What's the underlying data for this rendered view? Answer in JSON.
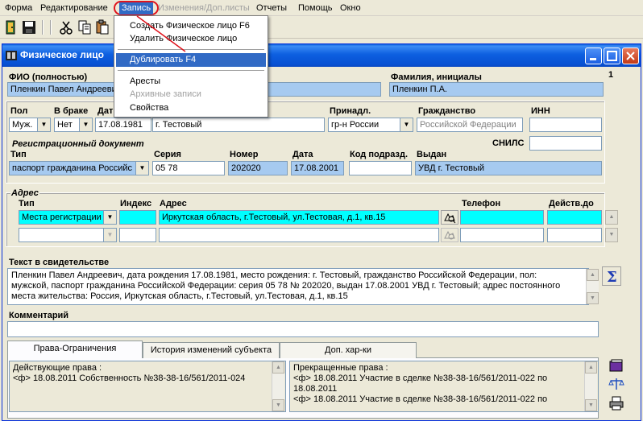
{
  "menubar": {
    "items": [
      "Форма",
      "Редактирование",
      "Запись",
      "Изменения/Доп.листы",
      "Отчеты",
      "Помощь",
      "Окно"
    ]
  },
  "dropdown": {
    "items": [
      {
        "label": "Создать Физическое лицо F6",
        "state": "normal"
      },
      {
        "label": "Удалить Физическое лицо",
        "state": "normal"
      },
      {
        "label": "Дублировать F4",
        "state": "highlighted"
      },
      {
        "label": "Аресты",
        "state": "normal"
      },
      {
        "label": "Архивные записи",
        "state": "disabled"
      },
      {
        "label": "Свойства",
        "state": "normal"
      }
    ]
  },
  "window": {
    "title": "Физическое лицо",
    "page_number": "1"
  },
  "form": {
    "fio_label": "ФИО (полностью)",
    "fio_value": "Пленкин Павел Андреевич",
    "surname_label": "Фамилия, инициалы",
    "surname_value": "Пленкин П.А.",
    "sex_label": "Пол",
    "sex_value": "Муж.",
    "married_label": "В браке",
    "married_value": "Нет",
    "birth_label": "Дат",
    "birth_value": "17.08.1981",
    "birthplace_value": "г. Тестовый",
    "affil_label": "Принадл.",
    "affil_value": "гр-н России",
    "citizen_label": "Гражданство",
    "citizen_value": "Российской Федерации",
    "inn_label": "ИНН",
    "inn_value": "",
    "snils_label": "СНИЛС",
    "snils_value": "",
    "regdoc_label": "Регистрационный документ",
    "doc_type_label": "Тип",
    "doc_type_value": "паспорт гражданина Российс",
    "series_label": "Серия",
    "series_value": "05 78",
    "number_label": "Номер",
    "number_value": "202020",
    "date_label": "Дата",
    "date_value": "17.08.2001",
    "subdiv_label": "Код подразд.",
    "subdiv_value": "",
    "issued_label": "Выдан",
    "issued_value": "УВД г. Тестовый",
    "address_group_label": "Адрес",
    "addr_type_label": "Тип",
    "addr_index_label": "Индекс",
    "addr_label": "Адрес",
    "phone_label": "Телефон",
    "valid_label": "Действ.до",
    "addr_rows": [
      {
        "type": "Места регистрации",
        "index": "",
        "address": "Иркутская область, г.Тестовый, ул.Тестовая, д.1, кв.15",
        "phone": "",
        "valid": ""
      },
      {
        "type": "",
        "index": "",
        "address": "",
        "phone": "",
        "valid": ""
      }
    ],
    "cert_label": "Текст в свидетельстве",
    "cert_text": "Пленкин Павел Андреевич, дата рождения 17.08.1981, место рождения: г. Тестовый, гражданство Российской Федерации, пол: мужской, паспорт гражданина Российской Федерации: серия 05 78 № 202020, выдан 17.08.2001 УВД г. Тестовый; адрес постоянного места жительства: Россия, Иркутская область, г.Тестовый, ул.Тестовая, д.1, кв.15",
    "comment_label": "Комментарий",
    "comment_value": ""
  },
  "tabs": [
    {
      "label": "Права-Ограничения",
      "active": true
    },
    {
      "label": "История изменений субъекта",
      "active": false
    },
    {
      "label": "Доп. хар-ки",
      "active": false
    }
  ],
  "rights": {
    "active_header": "Действующие права :",
    "active_rows": [
      "<ф> 18.08.2011  Собственность №38-38-16/561/2011-024"
    ],
    "ended_header": "Прекращенные права :",
    "ended_rows": [
      "<ф> 18.08.2011  Участие в сделке №38-38-16/561/2011-022 по 18.08.2011",
      "<ф> 18.08.2011  Участие в сделке №38-38-16/561/2011-022 по"
    ]
  },
  "colors": {
    "highlight": "#316ac5",
    "readonly_blue": "#a6caf0",
    "cyan": "#00ffff",
    "title_bar": "#0a5fdc",
    "annotation_red": "#e0141d"
  },
  "icons": {
    "toolbar": [
      "exit-door-icon",
      "save-disk-icon",
      "cut-scissors-icon",
      "copy-icon",
      "paste-icon"
    ],
    "side": [
      "sigma-icon",
      "book-icon",
      "scales-icon",
      "printer-icon",
      "map-search-icon"
    ]
  }
}
